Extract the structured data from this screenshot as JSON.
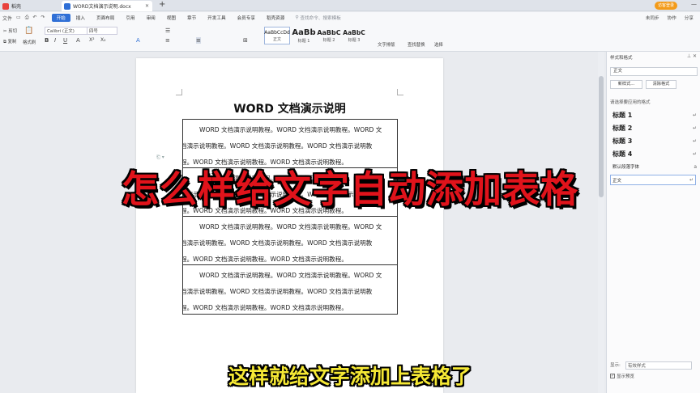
{
  "tabs": [
    {
      "label": "稻壳"
    },
    {
      "label": "WORD文档演示说明.docx"
    }
  ],
  "window": {
    "user_label": "访客登录"
  },
  "menu": {
    "quick_label": "文件",
    "items": [
      "开始",
      "插入",
      "页面布局",
      "引用",
      "审阅",
      "视图",
      "章节",
      "开发工具",
      "会员专享",
      "稻壳资源"
    ],
    "search_placeholder": "查找命令、搜索模板",
    "right": [
      "未同步",
      "协作",
      "分享"
    ]
  },
  "ribbon": {
    "cut": "剪切",
    "copy": "复制",
    "format_painter": "格式刷",
    "paste": "粘贴",
    "font_name": "Calibri (正文)",
    "font_size": "四号",
    "styles": [
      {
        "preview": "AaBbCcDd",
        "caption": "正文"
      },
      {
        "preview": "AaBb",
        "caption": "标题 1"
      },
      {
        "preview": "AaBbC",
        "caption": "标题 2"
      },
      {
        "preview": "AaBbC",
        "caption": "标题 3"
      }
    ],
    "text_layout": "文字排版",
    "find_replace": "查找替换",
    "select": "选择"
  },
  "document": {
    "title": "WORD 文档演示说明",
    "cells": [
      [
        "WORD 文档演示说明教程。WORD 文档演示说明教程。WORD 文",
        "档演示说明教程。WORD 文档演示说明教程。WORD 文档演示说明教",
        "程。WORD 文档演示说明教程。WORD 文档演示说明教程。"
      ],
      [
        "WORD 文档演示说明教程。WORD 文档演示说明教程。WORD 文",
        "档演示说明教程。WORD 文档演示说明教程。WORD 文档演示说明教",
        "程。WORD 文档演示说明教程。WORD 文档演示说明教程。"
      ],
      [
        "WORD 文档演示说明教程。WORD 文档演示说明教程。WORD 文",
        "档演示说明教程。WORD 文档演示说明教程。WORD 文档演示说明教",
        "程。WORD 文档演示说明教程。WORD 文档演示说明教程。"
      ],
      [
        "WORD 文档演示说明教程。WORD 文档演示说明教程。WORD 文",
        "档演示说明教程。WORD 文档演示说明教程。WORD 文档演示说明教",
        "程。WORD 文档演示说明教程。WORD 文档演示说明教程。"
      ]
    ]
  },
  "panel": {
    "title": "样式和格式",
    "current_style": "正文",
    "new_style": "新样式...",
    "clear_format": "清除格式",
    "apply_label": "请选择要应用的格式",
    "styles": [
      "标题 1",
      "标题 2",
      "标题 3",
      "标题 4"
    ],
    "default_font": "默认段落字体",
    "body_style": "正文",
    "show_label": "显示:",
    "show_value": "有效样式",
    "preview_label": "显示预览"
  },
  "overlay": {
    "headline": "怎么样给文字自动添加表格",
    "caption": "这样就给文字添加上表格了"
  },
  "colors": {
    "accent": "#2f6fd6",
    "headline": "#e0131b",
    "caption": "#f5e834"
  }
}
